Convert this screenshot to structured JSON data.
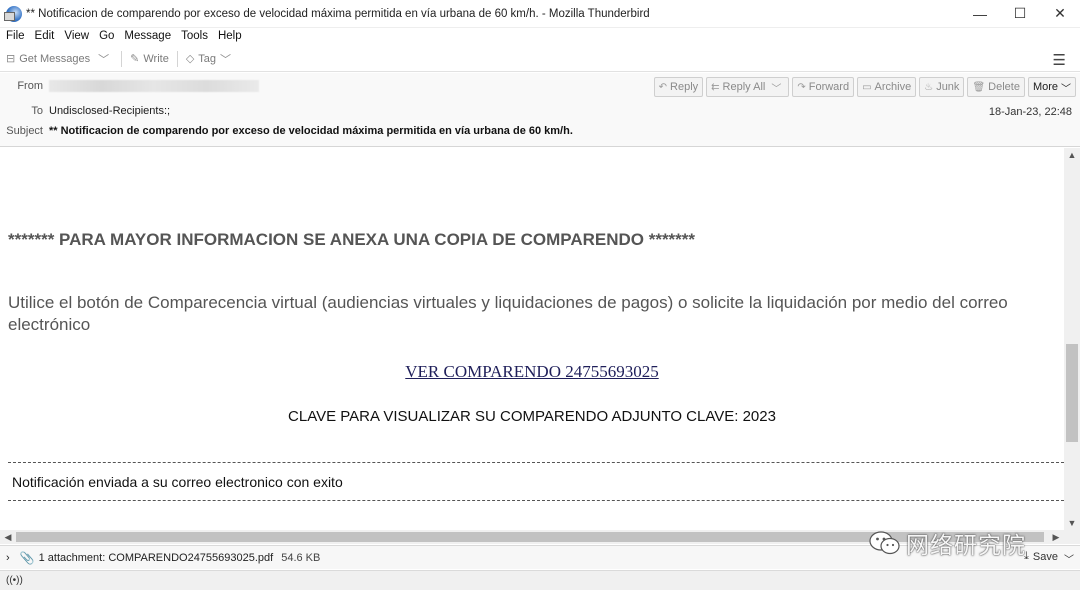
{
  "window": {
    "title": "** Notificacion de comparendo por exceso de velocidad máxima permitida en vía urbana de 60 km/h. - Mozilla Thunderbird",
    "minimize": "—",
    "maximize": "☐",
    "close": "✕"
  },
  "menu": [
    "File",
    "Edit",
    "View",
    "Go",
    "Message",
    "Tools",
    "Help"
  ],
  "toolbar": {
    "get_messages": "Get Messages",
    "write": "Write",
    "tag": "Tag",
    "menu_icon": "☰"
  },
  "header": {
    "from_label": "From",
    "to_label": "To",
    "to_value": "Undisclosed-Recipients:;",
    "subject_label": "Subject",
    "subject_value": "** Notificacion de comparendo por exceso de velocidad máxima permitida en vía urbana de 60 km/h.",
    "date": "18-Jan-23, 22:48",
    "buttons": {
      "reply": "Reply",
      "reply_all": "Reply All",
      "forward": "Forward",
      "archive": "Archive",
      "junk": "Junk",
      "delete": "Delete",
      "more": "More"
    }
  },
  "message": {
    "heading": "******* PARA MAYOR INFORMACION SE ANEXA UNA COPIA DE COMPARENDO *******",
    "paragraph": "Utilice el botón de Comparecencia virtual (audiencias virtuales y liquidaciones de pagos) o solicite la liquidación por medio del correo electrónico",
    "link": "VER COMPARENDO 24755693025",
    "clave": "CLAVE PARA VISUALIZAR SU COMPARENDO ADJUNTO CLAVE:  2023",
    "notification": "Notificación enviada a su correo electronico con exito"
  },
  "attachment": {
    "summary": "1 attachment: COMPARENDO24755693025.pdf",
    "size": "54.6 KB",
    "save": "Save"
  },
  "watermark": {
    "text": "网络研究院"
  }
}
